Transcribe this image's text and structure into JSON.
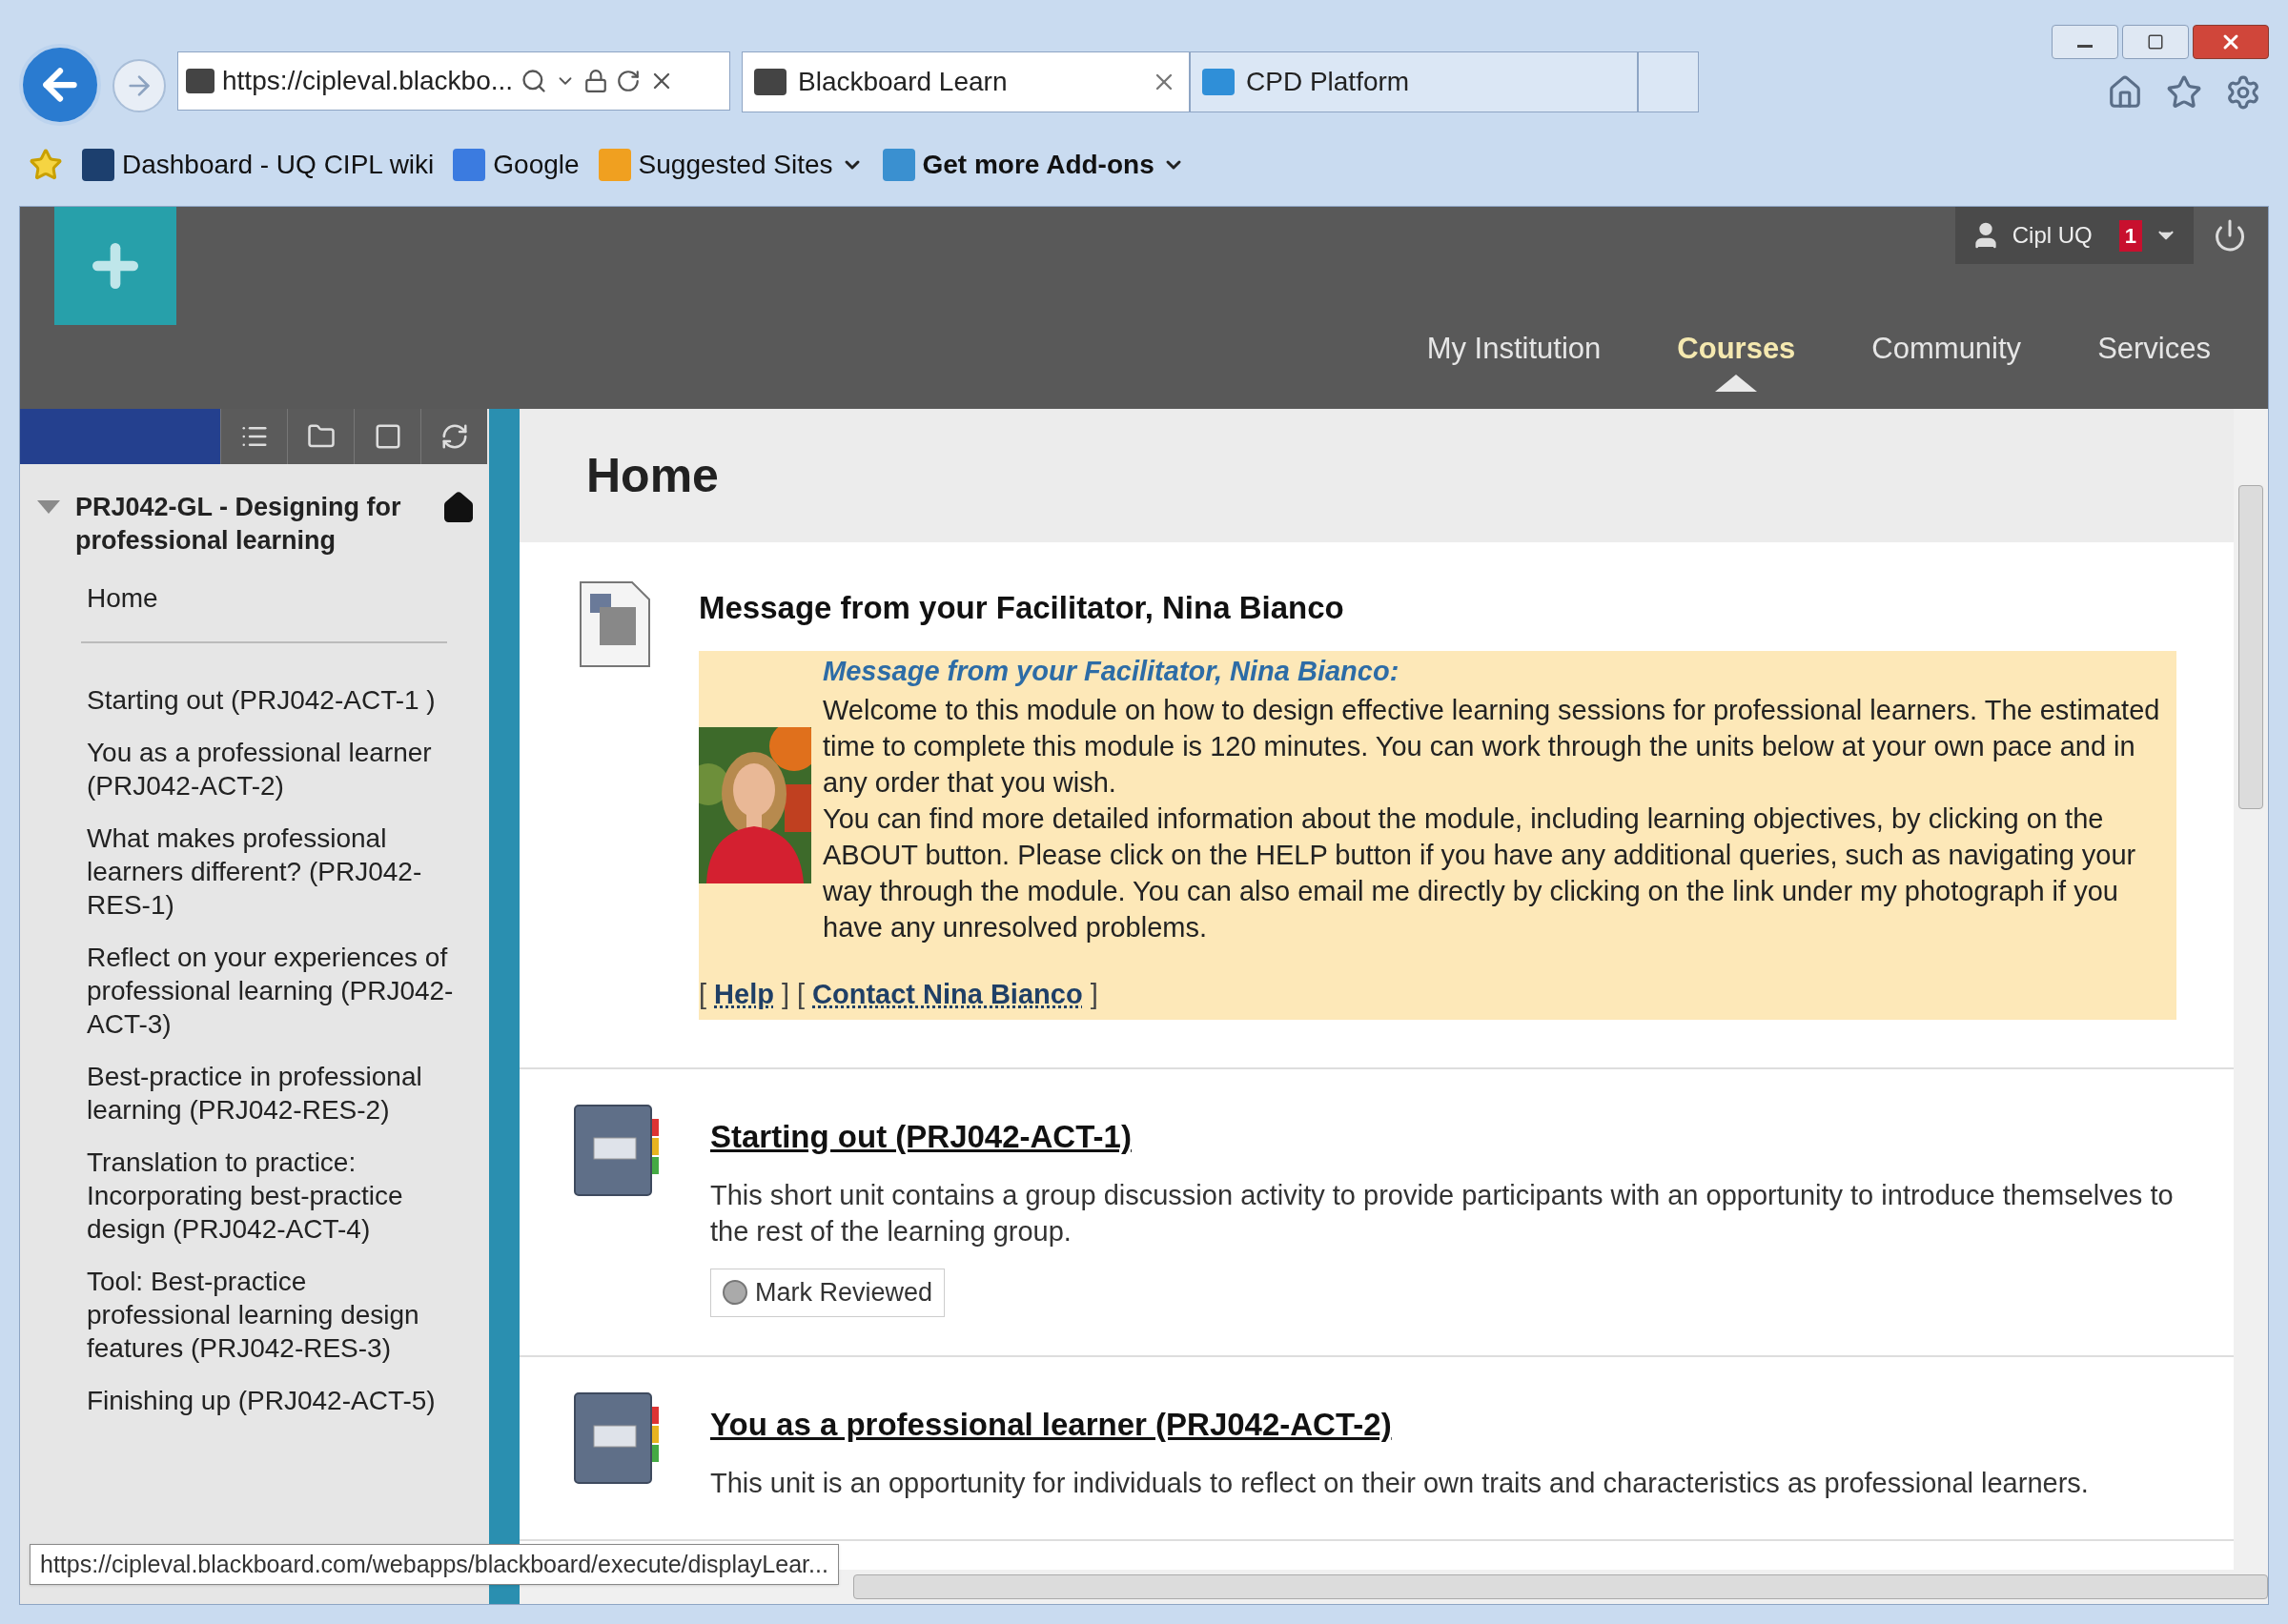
{
  "browser": {
    "address": "https://cipleval.blackbo...",
    "tabs": [
      {
        "label": "Blackboard Learn",
        "selected": true,
        "closable": true
      },
      {
        "label": "CPD Platform",
        "selected": false,
        "closable": false
      }
    ],
    "favorites": [
      {
        "label": "Dashboard - UQ CIPL wiki",
        "menu": false,
        "bold": false
      },
      {
        "label": "Google",
        "menu": false,
        "bold": false
      },
      {
        "label": "Suggested Sites",
        "menu": true,
        "bold": false
      },
      {
        "label": "Get more Add-ons",
        "menu": true,
        "bold": true
      }
    ]
  },
  "header": {
    "user": "Cipl UQ",
    "notifications": "1",
    "nav": [
      {
        "label": "My Institution",
        "selected": false
      },
      {
        "label": "Courses",
        "selected": true
      },
      {
        "label": "Community",
        "selected": false
      },
      {
        "label": "Services",
        "selected": false
      }
    ]
  },
  "sidebar": {
    "course_title": "PRJ042-GL - Designing for professional learning",
    "expanded": true,
    "home": "Home",
    "items": [
      "Starting out (PRJ042-ACT-1 )",
      "You as a professional learner (PRJ042-ACT-2)",
      "What makes professional learners different? (PRJ042-RES-1)",
      "Reflect on your experiences of professional learning (PRJ042-ACT-3)",
      "Best-practice in professional learning (PRJ042-RES-2)",
      "Translation to practice: Incorporating best-practice design (PRJ042-ACT-4)",
      "Tool: Best-practice professional learning design features (PRJ042-RES-3)",
      "Finishing up (PRJ042-ACT-5)"
    ]
  },
  "page": {
    "title": "Home",
    "items": [
      {
        "kind": "message",
        "title": "Message from your Facilitator, Nina Bianco",
        "heading": "Message from your Facilitator, Nina Bianco:",
        "paragraphs": [
          "Welcome to this module on how to design effective learning sessions for professional learners. The estimated time to complete this module is 120 minutes. You can work through the units below at your own pace and in any order that you wish.",
          "You can find more detailed information about the module, including learning objectives, by clicking on the ABOUT button. Please click on the HELP button if you have any additional queries, such as navigating your way through the module. You can also email me directly by clicking on the link under my photograph if you have any unresolved problems."
        ],
        "links": [
          {
            "before": "[",
            "label": "Help",
            "after": "]"
          },
          {
            "before": "[",
            "label": "Contact Nina Bianco",
            "after": "]"
          }
        ]
      },
      {
        "kind": "unit",
        "title": "Starting out (PRJ042-ACT-1)",
        "description": "This short unit contains a group discussion activity to provide participants with an opportunity to introduce themselves to the rest of the learning group.",
        "button": "Mark Reviewed"
      },
      {
        "kind": "unit",
        "title": "You as a professional learner (PRJ042-ACT-2)",
        "description": "This unit is an opportunity for individuals to reflect on their own traits and characteristics as professional learners."
      }
    ]
  },
  "status_url": "https://cipleval.blackboard.com/webapps/blackboard/execute/displayLear..."
}
